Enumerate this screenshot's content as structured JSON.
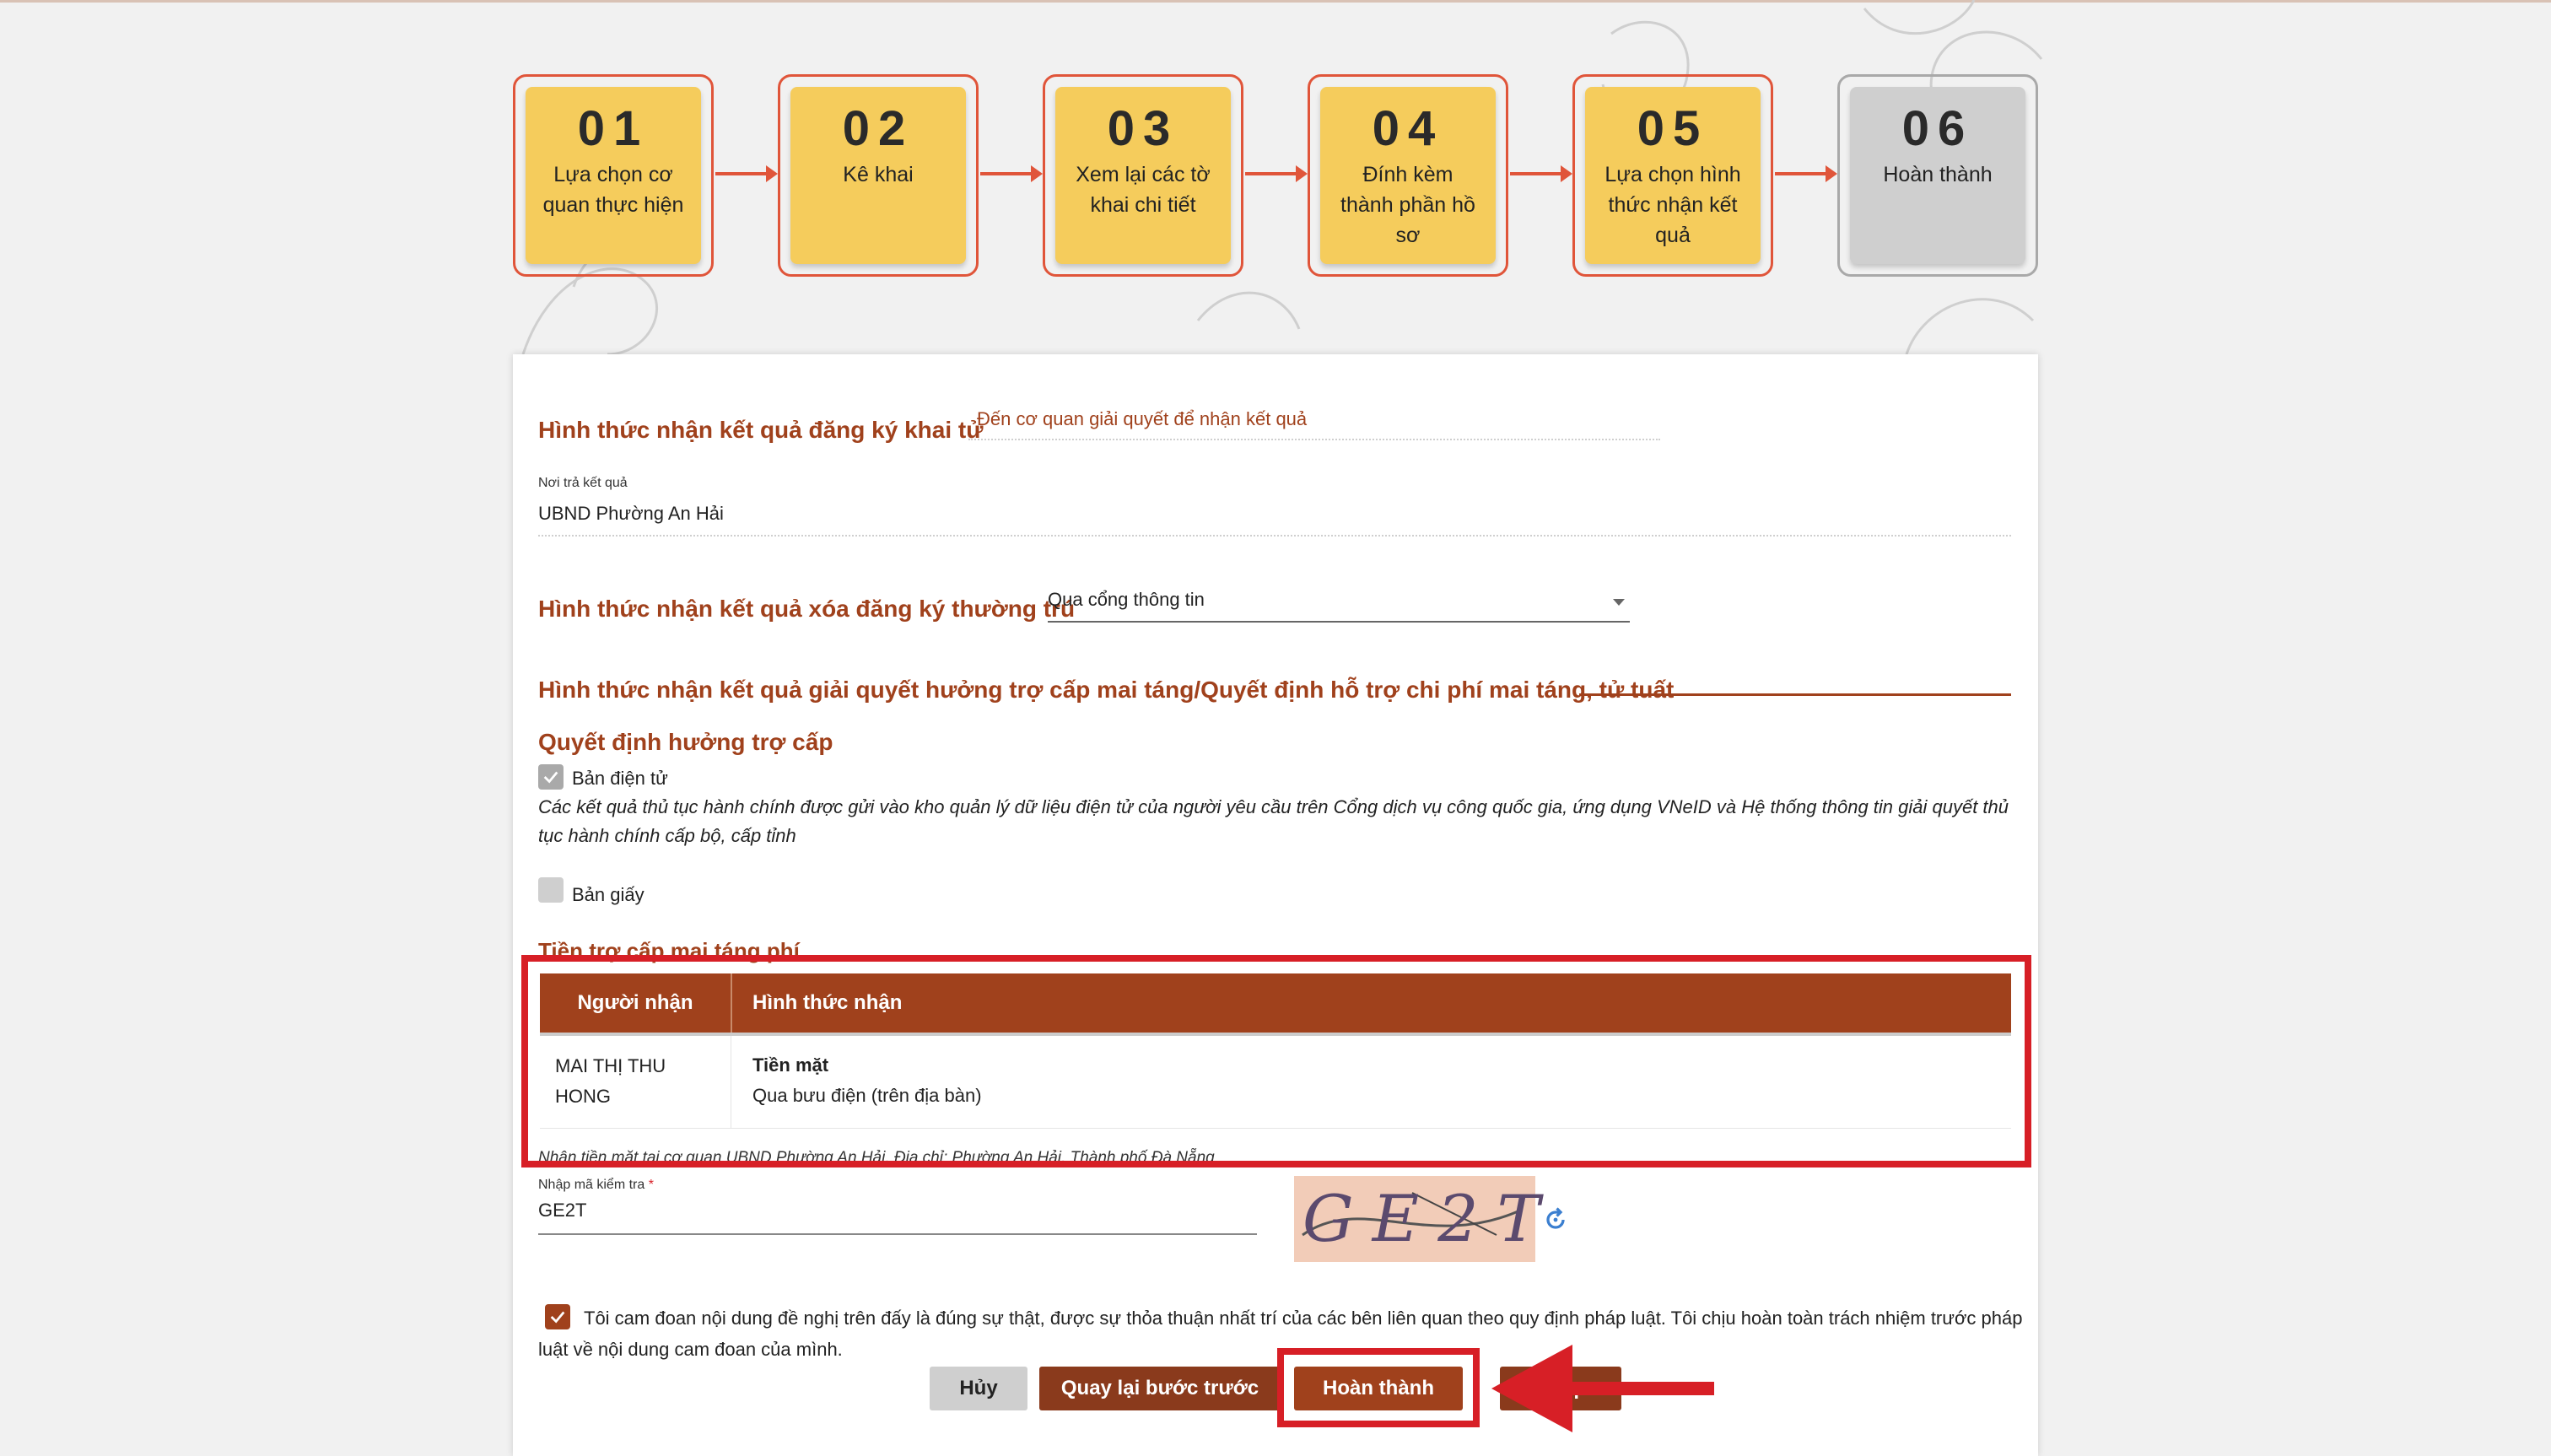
{
  "steps": [
    {
      "num": "01",
      "label": "Lựa chọn cơ quan thực hiện",
      "state": "done"
    },
    {
      "num": "02",
      "label": "Kê khai",
      "state": "done"
    },
    {
      "num": "03",
      "label": "Xem lại các tờ khai chi tiết",
      "state": "done"
    },
    {
      "num": "04",
      "label": "Đính kèm thành phần hồ sơ",
      "state": "done"
    },
    {
      "num": "05",
      "label": "Lựa chọn hình thức nhận kết quả",
      "state": "done"
    },
    {
      "num": "06",
      "label": "Hoàn thành",
      "state": "pending"
    }
  ],
  "form": {
    "death_reg": {
      "label": "Hình thức nhận kết quả đăng ký khai tử",
      "value": "Đến cơ quan giải quyết để nhận kết quả"
    },
    "return_place": {
      "label": "Nơi trả kết quả",
      "value": "UBND Phường An Hải"
    },
    "residence": {
      "label": "Hình thức nhận kết quả xóa đăng ký thường trú",
      "value": "Qua cổng thông tin"
    },
    "funeral": {
      "label": "Hình thức nhận kết quả giải quyết hưởng trợ cấp mai táng/Quyết định hỗ trợ chi phí mai táng, tử tuất"
    },
    "decision": {
      "label": "Quyết định hưởng trợ cấp",
      "electronic_label": "Bản điện tử",
      "electronic_checked": true,
      "electronic_note": "Các kết quả thủ tục hành chính được gửi vào kho quản lý dữ liệu điện tử của người yêu cầu trên Cổng dịch vụ công quốc gia, ứng dụng VNeID và Hệ thống thông tin giải quyết thủ tục hành chính cấp bộ, cấp tỉnh",
      "paper_label": "Bản giấy",
      "paper_checked": false
    },
    "allowance": {
      "label": "Tiền trợ cấp mai táng phí",
      "columns": [
        "Người nhận",
        "Hình thức nhận"
      ],
      "rows": [
        {
          "recipient": "MAI THỊ THU HONG",
          "method_title": "Tiền mặt",
          "method_detail": "Qua bưu điện (trên địa bàn)"
        }
      ],
      "note": "Nhận tiền mặt tại cơ quan UBND Phường An Hải, Địa chỉ: Phường An Hải, Thành phố Đà Nẵng"
    },
    "captcha": {
      "label": "Nhập mã kiểm tra",
      "required_mark": "*",
      "value": "GE2T",
      "image_text": "GE2T"
    },
    "pledge": {
      "checked": true,
      "text": "Tôi cam đoan nội dung đề nghị trên đấy là đúng sự thật, được sự thỏa thuận nhất trí của các bên liên quan theo quy định pháp luật. Tôi chịu hoàn toàn trách nhiệm trước pháp luật về nội dung cam đoan của mình."
    }
  },
  "buttons": {
    "cancel": "Hủy",
    "back": "Quay lại bước trước",
    "finish": "Hoàn thành",
    "next_partial": "...p"
  },
  "colors": {
    "accent": "#a0411c",
    "step_done": "#f5cc5c",
    "step_border": "#e0553a",
    "step_pending": "#cfcfcf",
    "annotation": "#d71f26"
  }
}
